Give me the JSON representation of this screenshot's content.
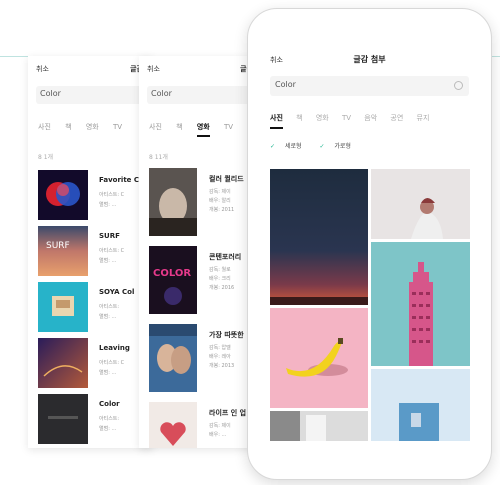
{
  "left_panel": {
    "cancel": "취소",
    "title": "글감",
    "search_value": "Color",
    "tabs": [
      "사진",
      "책",
      "영화",
      "TV"
    ],
    "active_tab": 3,
    "count": "8 1개",
    "items": [
      {
        "title": "Favorite C",
        "line1": "아티스트: C",
        "line2": "앨범: ..."
      },
      {
        "title": "SURF",
        "line1": "아티스트: C",
        "line2": "앨범: ..."
      },
      {
        "title": "SOYA Col",
        "line1": "아티스트: ",
        "line2": "앨범: ..."
      },
      {
        "title": "Leaving",
        "line1": "아티스트: C",
        "line2": "앨범: ..."
      },
      {
        "title": "Color",
        "line1": "아티스트: ",
        "line2": "앨범: ..."
      }
    ]
  },
  "middle_panel": {
    "cancel": "취소",
    "title": "글감",
    "search_value": "Color",
    "tabs": [
      "사진",
      "책",
      "영화",
      "TV"
    ],
    "active_tab": 2,
    "count": "8 11개",
    "items": [
      {
        "title": "컬러 퀼리드",
        "line1": "감독: 제이",
        "line2": "배우: 알리",
        "line3": "개봉: 2011"
      },
      {
        "title": "콘텐포러리",
        "line1": "감독: 월로",
        "line2": "배우: 크리",
        "line3": "개봉: 2016"
      },
      {
        "title": "가장 따뜻한",
        "line1": "감독: 압델",
        "line2": "배우: 레아",
        "line3": "개봉: 2013"
      },
      {
        "title": "라이프 인 업",
        "line1": "감독: 제이",
        "line2": "배우: ...",
        "line3": ""
      }
    ]
  },
  "phone": {
    "cancel": "취소",
    "title": "글감 첨부",
    "search_value": "Color",
    "tabs": [
      "사진",
      "책",
      "영화",
      "TV",
      "음악",
      "공연",
      "뮤지"
    ],
    "active_tab": 0,
    "filters": [
      "세로형",
      "가로형"
    ]
  },
  "colors": {
    "accent_teal": "#19b38e",
    "divider_line": "#bfe3e0"
  },
  "icons": {
    "check": "check-icon",
    "clear": "clear-icon"
  }
}
